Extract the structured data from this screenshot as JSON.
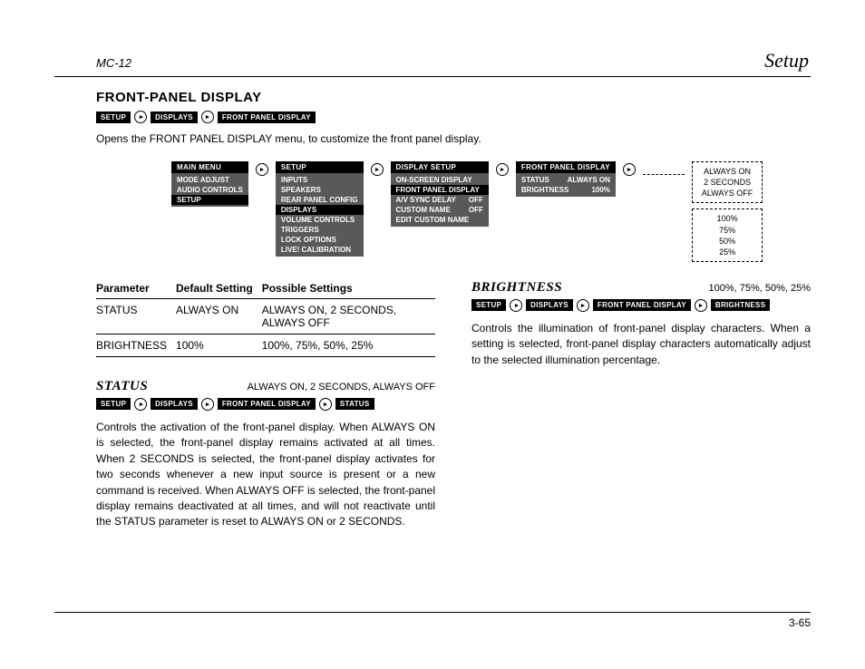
{
  "header": {
    "left": "MC-12",
    "right": "Setup"
  },
  "title": "FRONT-PANEL DISPLAY",
  "breadcrumb_main": [
    "SETUP",
    "DISPLAYS",
    "FRONT PANEL DISPLAY"
  ],
  "intro": "Opens the FRONT PANEL DISPLAY menu, to customize the front panel display.",
  "menus": {
    "main": {
      "title": "MAIN MENU",
      "items": [
        "MODE ADJUST",
        "AUDIO CONTROLS",
        "SETUP"
      ],
      "selected": 2
    },
    "setup": {
      "title": "SETUP",
      "items": [
        "INPUTS",
        "SPEAKERS",
        "REAR PANEL CONFIG",
        "DISPLAYS",
        "VOLUME CONTROLS",
        "TRIGGERS",
        "LOCK OPTIONS",
        "LIVE! CALIBRATION"
      ],
      "selected": 3
    },
    "display": {
      "title": "DISPLAY SETUP",
      "items": [
        {
          "l": "ON-SCREEN DISPLAY"
        },
        {
          "l": "FRONT PANEL DISPLAY"
        },
        {
          "l": "A/V SYNC DELAY",
          "v": "OFF"
        },
        {
          "l": "CUSTOM NAME",
          "v": "OFF"
        },
        {
          "l": "EDIT CUSTOM NAME"
        }
      ],
      "selected": 1
    },
    "front": {
      "title": "FRONT PANEL DISPLAY",
      "items": [
        {
          "l": "STATUS",
          "v": "ALWAYS ON"
        },
        {
          "l": "BRIGHTNESS",
          "v": "100%"
        }
      ]
    },
    "status_opts": [
      "ALWAYS ON",
      "2 SECONDS",
      "ALWAYS OFF"
    ],
    "bright_opts": [
      "100%",
      "75%",
      "50%",
      "25%"
    ]
  },
  "table": {
    "headers": [
      "Parameter",
      "Default Setting",
      "Possible Settings"
    ],
    "rows": [
      [
        "STATUS",
        "ALWAYS ON",
        "ALWAYS ON, 2 SECONDS, ALWAYS OFF"
      ],
      [
        "BRIGHTNESS",
        "100%",
        "100%, 75%, 50%, 25%"
      ]
    ]
  },
  "status_section": {
    "name": "STATUS",
    "opts": "ALWAYS ON, 2 SECONDS, ALWAYS OFF",
    "crumb": [
      "SETUP",
      "DISPLAYS",
      "FRONT PANEL DISPLAY",
      "STATUS"
    ],
    "body": "Controls the activation of the front-panel display. When ALWAYS ON is selected, the front-panel display remains activated at all times. When 2 SECONDS is selected, the front-panel display activates for two seconds whenever a new input source is present or a new command is received. When ALWAYS OFF is selected, the front-panel display remains deactivated at all times, and will not reactivate until the STATUS parameter is reset to ALWAYS ON or 2 SECONDS."
  },
  "brightness_section": {
    "name": "BRIGHTNESS",
    "opts": "100%, 75%, 50%, 25%",
    "crumb": [
      "SETUP",
      "DISPLAYS",
      "FRONT PANEL DISPLAY",
      "BRIGHTNESS"
    ],
    "body": "Controls the illumination of front-panel display characters. When a setting is selected, front-panel display characters automatically adjust to the selected illumination percentage."
  },
  "page_number": "3-65"
}
